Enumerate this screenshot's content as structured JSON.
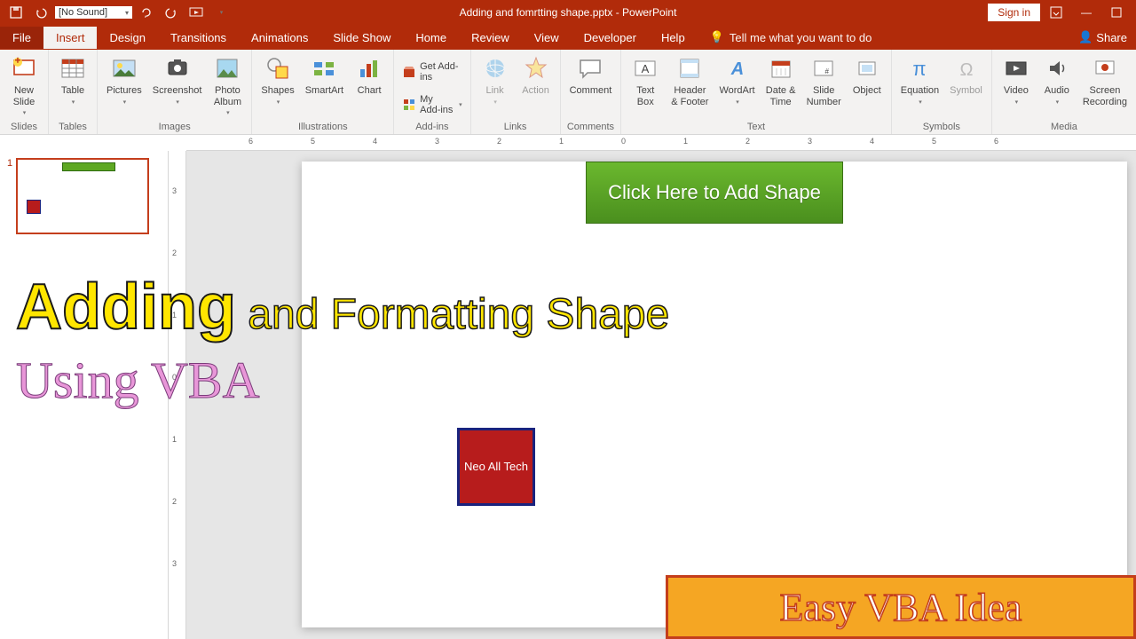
{
  "titlebar": {
    "qat_sound": "[No Sound]",
    "title": "Adding and fomrtting shape.pptx - PowerPoint",
    "signin": "Sign in",
    "share": "Share"
  },
  "menu": {
    "file": "File",
    "insert": "Insert",
    "design": "Design",
    "transitions": "Transitions",
    "animations": "Animations",
    "slideshow": "Slide Show",
    "home": "Home",
    "review": "Review",
    "view": "View",
    "developer": "Developer",
    "help": "Help",
    "tellme": "Tell me what you want to do"
  },
  "ribbon": {
    "slides": {
      "newslide": "New\nSlide",
      "group": "Slides"
    },
    "tables": {
      "table": "Table",
      "group": "Tables"
    },
    "images": {
      "pictures": "Pictures",
      "screenshot": "Screenshot",
      "photoalbum": "Photo\nAlbum",
      "group": "Images"
    },
    "illus": {
      "shapes": "Shapes",
      "smartart": "SmartArt",
      "chart": "Chart",
      "group": "Illustrations"
    },
    "addins": {
      "get": "Get Add-ins",
      "my": "My Add-ins",
      "group": "Add-ins"
    },
    "links": {
      "link": "Link",
      "action": "Action",
      "group": "Links"
    },
    "comments": {
      "comment": "Comment",
      "group": "Comments"
    },
    "text": {
      "textbox": "Text\nBox",
      "headerfooter": "Header\n& Footer",
      "wordart": "WordArt",
      "datetime": "Date &\nTime",
      "slidenum": "Slide\nNumber",
      "object": "Object",
      "group": "Text"
    },
    "symbols": {
      "equation": "Equation",
      "symbol": "Symbol",
      "group": "Symbols"
    },
    "media": {
      "video": "Video",
      "audio": "Audio",
      "screenrec": "Screen\nRecording",
      "group": "Media"
    }
  },
  "slide": {
    "green_btn": "Click Here to Add Shape",
    "red_sq": "Neo All Tech",
    "thumb_num": "1"
  },
  "overlay": {
    "adding": "Adding",
    "and": " and Formatting Shape",
    "line2": "Using VBA",
    "badge": "Easy VBA Idea"
  }
}
